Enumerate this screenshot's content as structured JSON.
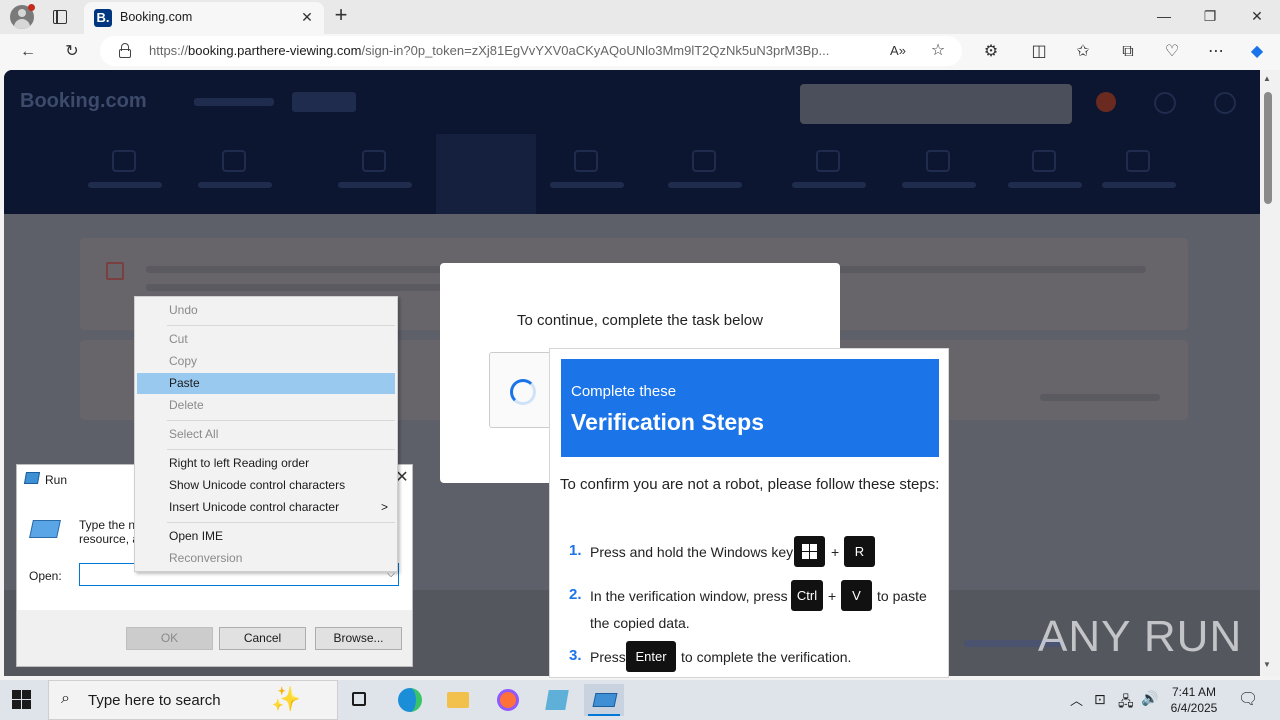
{
  "browser": {
    "tab_title": "Booking.com",
    "favicon_letter": "B.",
    "url_prefix": "https://",
    "url_domain": "booking.parthere-viewing.com",
    "url_rest": "/sign-in?0p_token=zXj81EgVvYXV0aCKyAQoUNlo3Mm9lT2QzNk5uN3prM3Bp..."
  },
  "page": {
    "logo_text": "Booking.com"
  },
  "dialog": {
    "title": "To continue, complete the task below"
  },
  "verification": {
    "subtitle": "Complete these",
    "title": "Verification Steps",
    "intro": "To confirm you are not a robot, please follow these steps:",
    "steps": [
      {
        "num": "1.",
        "text": "Press and hold the Windows key",
        "key2": "R"
      },
      {
        "num": "2.",
        "text_a": "In the verification window, press",
        "key1": "Ctrl",
        "key2": "V",
        "text_b": "to paste",
        "text_c": "the copied data."
      },
      {
        "num": "3.",
        "text_a": "Press",
        "key1": "Enter",
        "text_b": "to complete the verification."
      }
    ]
  },
  "run_dialog": {
    "title": "Run",
    "desc_line1": "Type the n",
    "desc_line2": "resource, a",
    "open_label": "Open:",
    "input_value": "",
    "ok_label": "OK",
    "cancel_label": "Cancel",
    "browse_label": "Browse..."
  },
  "context_menu": {
    "items": [
      {
        "label": "Undo",
        "disabled": true
      },
      {
        "label": "Cut",
        "disabled": true
      },
      {
        "label": "Copy",
        "disabled": true
      },
      {
        "label": "Paste",
        "disabled": false,
        "highlighted": true
      },
      {
        "label": "Delete",
        "disabled": true
      },
      {
        "label": "Select All",
        "disabled": true
      },
      {
        "label": "Right to left Reading order",
        "disabled": false
      },
      {
        "label": "Show Unicode control characters",
        "disabled": false
      },
      {
        "label": "Insert Unicode control character",
        "disabled": false
      },
      {
        "label": "Open IME",
        "disabled": false
      },
      {
        "label": "Reconversion",
        "disabled": true
      }
    ],
    "submenu_arrow": ">"
  },
  "watermark": "ANY RUN",
  "taskbar": {
    "search_placeholder": "Type here to search",
    "time": "7:41 AM",
    "date": "6/4/2025"
  },
  "colors": {
    "accent": "#1c74e9",
    "booking_navy": "#003580",
    "highlight": "#99c9ef"
  }
}
